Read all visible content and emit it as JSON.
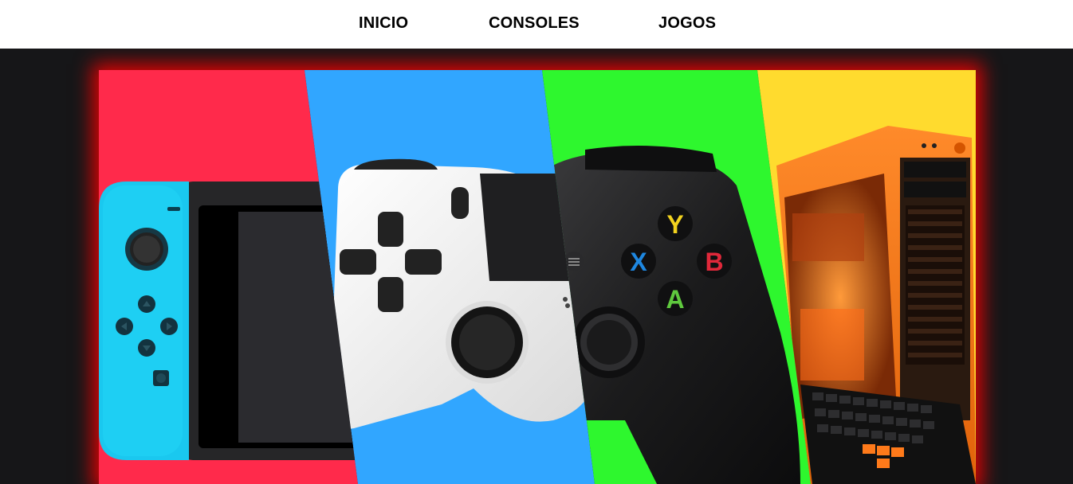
{
  "nav": {
    "items": [
      {
        "label": "INICIO"
      },
      {
        "label": "CONSOLES"
      },
      {
        "label": "JOGOS"
      }
    ]
  },
  "banner": {
    "panel_colors": [
      "#ff2a4b",
      "#31a6ff",
      "#2ef72e",
      "#ffdb2e"
    ],
    "glow_color": "#ff0000",
    "depicts": [
      "switch-console",
      "white-gamepad",
      "black-xbox-controller",
      "orange-gaming-pc-with-keyboard"
    ],
    "xbox_buttons": {
      "y": "Y",
      "x": "X",
      "b": "B",
      "a": "A"
    }
  }
}
